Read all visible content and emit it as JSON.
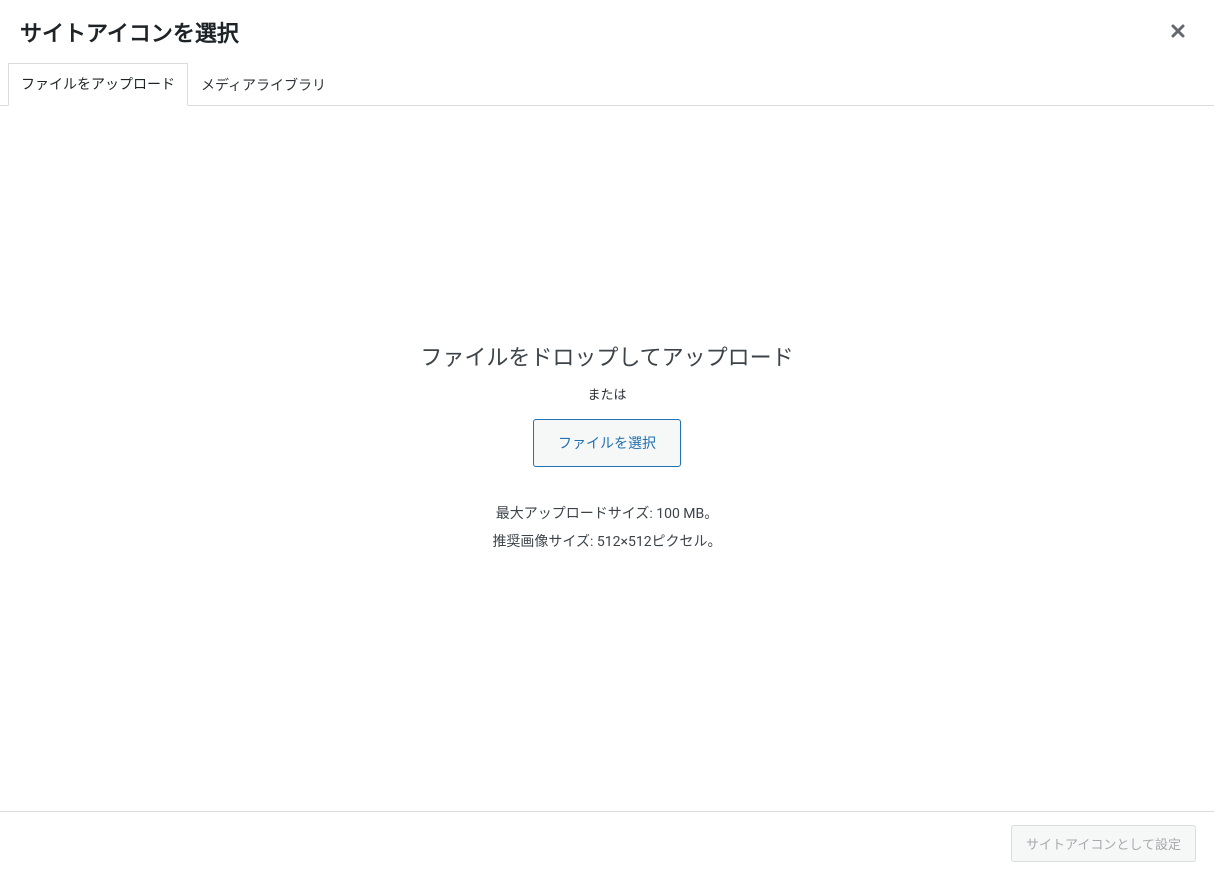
{
  "header": {
    "title": "サイトアイコンを選択"
  },
  "tabs": {
    "upload": "ファイルをアップロード",
    "media_library": "メディアライブラリ"
  },
  "upload": {
    "drop_title": "ファイルをドロップしてアップロード",
    "or": "または",
    "select_button": "ファイルを選択",
    "max_size": "最大アップロードサイズ: 100 MB。",
    "recommended_size": "推奨画像サイズ: 512×512ピクセル。"
  },
  "footer": {
    "set_button": "サイトアイコンとして設定"
  }
}
